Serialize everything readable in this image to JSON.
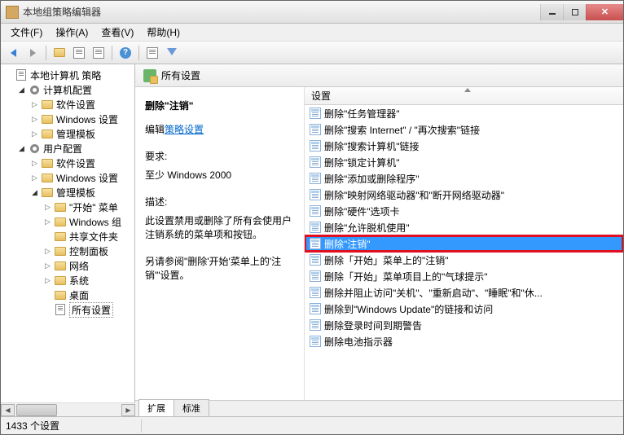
{
  "window": {
    "title": "本地组策略编辑器"
  },
  "menu": {
    "file": "文件(F)",
    "action": "操作(A)",
    "view": "查看(V)",
    "help": "帮助(H)"
  },
  "tree": {
    "root": "本地计算机 策略",
    "computer_config": "计算机配置",
    "software_settings": "软件设置",
    "windows_settings": "Windows 设置",
    "admin_templates": "管理模板",
    "user_config": "用户配置",
    "start_menu": "\"开始\" 菜单",
    "windows_components": "Windows 组",
    "shared_folders": "共享文件夹",
    "control_panel": "控制面板",
    "network": "网络",
    "system": "系统",
    "desktop": "桌面",
    "all_settings": "所有设置"
  },
  "detail": {
    "header": "所有设置",
    "info_title": "删除\"注销\"",
    "edit_prefix": "编辑",
    "edit_link": "策略设置",
    "req_label": "要求:",
    "req_value": "至少 Windows 2000",
    "desc_label": "描述:",
    "desc_value": "此设置禁用或删除了所有会使用户注销系统的菜单项和按钮。",
    "also_see": "另请参阅\"删除'开始'菜单上的'注销'\"设置。",
    "col_header": "设置"
  },
  "settings_list": [
    "删除\"任务管理器\"",
    "删除\"搜索 Internet\" / \"再次搜索\"链接",
    "删除\"搜索计算机\"链接",
    "删除\"锁定计算机\"",
    "删除\"添加或删除程序\"",
    "删除\"映射网络驱动器\"和\"断开网络驱动器\"",
    "删除\"硬件\"选项卡",
    "删除\"允许脱机使用\"",
    "删除\"注销\"",
    "删除「开始」菜单上的\"注销\"",
    "删除「开始」菜单项目上的\"气球提示\"",
    "删除并阻止访问\"关机\"、\"重新启动\"、\"睡眠\"和\"休...",
    "删除到\"Windows Update\"的链接和访问",
    "删除登录时间到期警告",
    "删除电池指示器"
  ],
  "selected_index": 8,
  "highlighted_index": 8,
  "tabs": {
    "extended": "扩展",
    "standard": "标准"
  },
  "status": {
    "count": "1433 个设置"
  }
}
